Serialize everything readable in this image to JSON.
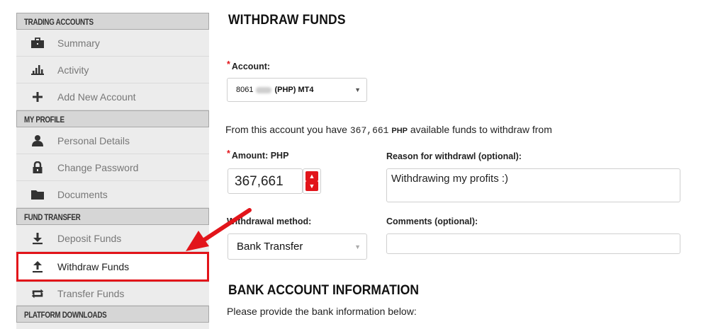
{
  "sidebar": {
    "sections": [
      {
        "header": "TRADING ACCOUNTS",
        "items": [
          {
            "label": "Summary",
            "icon": "briefcase-icon"
          },
          {
            "label": "Activity",
            "icon": "bar-chart-icon"
          },
          {
            "label": "Add New Account",
            "icon": "plus-icon"
          }
        ]
      },
      {
        "header": "MY PROFILE",
        "items": [
          {
            "label": "Personal Details",
            "icon": "user-icon"
          },
          {
            "label": "Change Password",
            "icon": "lock-icon"
          },
          {
            "label": "Documents",
            "icon": "folder-icon"
          }
        ]
      },
      {
        "header": "FUND TRANSFER",
        "items": [
          {
            "label": "Deposit Funds",
            "icon": "download-icon"
          },
          {
            "label": "Withdraw Funds",
            "icon": "upload-icon",
            "active": true
          },
          {
            "label": "Transfer Funds",
            "icon": "transfer-icon"
          }
        ]
      },
      {
        "header": "PLATFORM DOWNLOADS",
        "items": []
      }
    ]
  },
  "main": {
    "title": "WITHDRAW FUNDS",
    "account": {
      "label": "Account:",
      "value_prefix": "8061",
      "value_suffix": "(PHP)  MT4"
    },
    "info": {
      "before": "From this account you have ",
      "amount": "367,661",
      "currency": "PHP",
      "after": " available funds to withdraw from"
    },
    "amount": {
      "label": "Amount: PHP",
      "value": "367,661"
    },
    "reason": {
      "label": "Reason for withdrawl (optional):",
      "value": "Withdrawing my profits :)"
    },
    "method": {
      "label": "Withdrawal method:",
      "value": "Bank Transfer"
    },
    "comments": {
      "label": "Comments (optional):",
      "value": ""
    },
    "bank_section": {
      "title": "BANK ACCOUNT INFORMATION",
      "helper": "Please provide the bank information below:"
    }
  },
  "colors": {
    "accent": "#e2141a",
    "sidebar_bg": "#ececec",
    "header_bg": "#d6d6d6"
  }
}
